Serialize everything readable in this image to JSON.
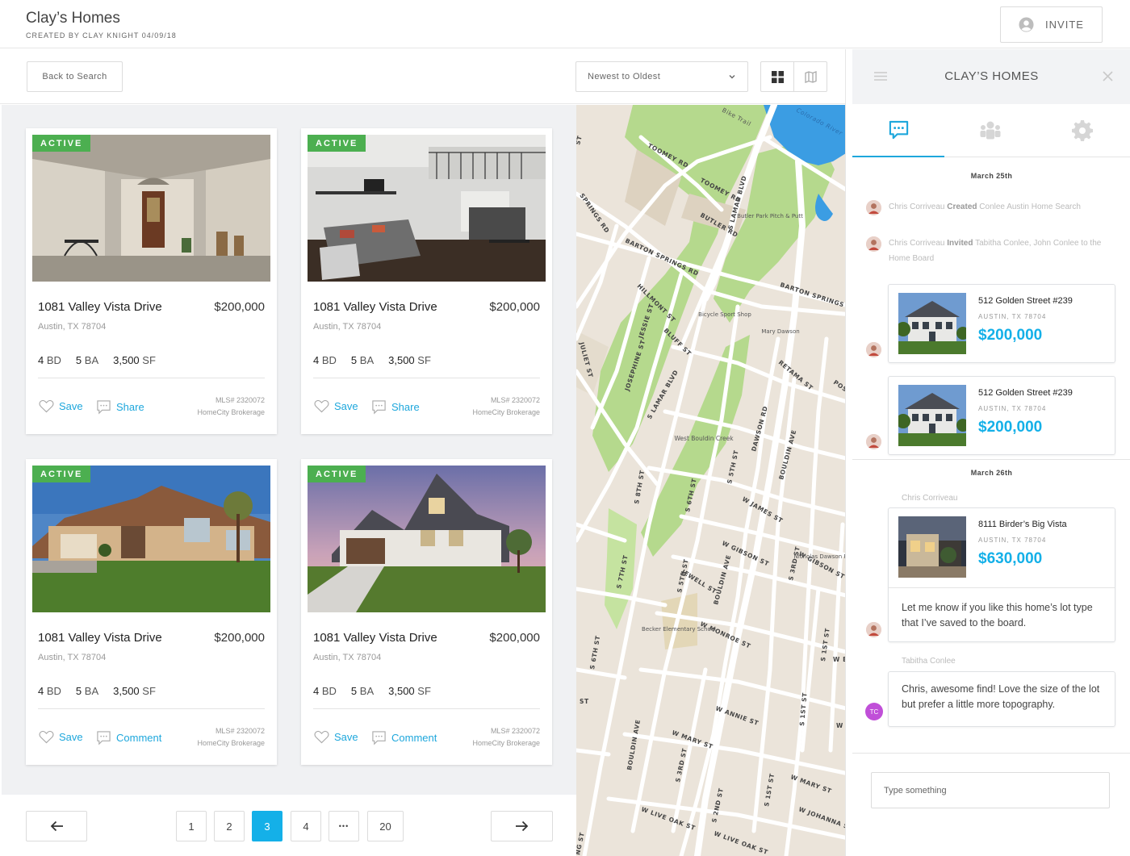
{
  "header": {
    "title": "Clay’s Homes",
    "subtitle": "CREATED BY CLAY KNIGHT 04/09/18",
    "invite_label": "INVITE"
  },
  "toolbar": {
    "back_label": "Back to Search",
    "sort_value": "Newest to Oldest"
  },
  "listings": [
    {
      "status": "ACTIVE",
      "address": "1081 Valley Vista Drive",
      "price": "$200,000",
      "city": "Austin, TX 78704",
      "beds": "4",
      "beds_unit": "BD",
      "baths": "5",
      "baths_unit": "BA",
      "sqft": "3,500",
      "sqft_unit": "SF",
      "save_label": "Save",
      "secondary_label": "Share",
      "mls": "MLS# 2320072",
      "brokerage": "HomeCity Brokerage",
      "photo": "porch"
    },
    {
      "status": "ACTIVE",
      "address": "1081 Valley Vista Drive",
      "price": "$200,000",
      "city": "Austin, TX 78704",
      "beds": "4",
      "beds_unit": "BD",
      "baths": "5",
      "baths_unit": "BA",
      "sqft": "3,500",
      "sqft_unit": "SF",
      "save_label": "Save",
      "secondary_label": "Share",
      "mls": "MLS# 2320072",
      "brokerage": "HomeCity Brokerage",
      "photo": "interior"
    },
    {
      "status": "ACTIVE",
      "address": "1081 Valley Vista Drive",
      "price": "$200,000",
      "city": "Austin, TX 78704",
      "beds": "4",
      "beds_unit": "BD",
      "baths": "5",
      "baths_unit": "BA",
      "sqft": "3,500",
      "sqft_unit": "SF",
      "save_label": "Save",
      "secondary_label": "Comment",
      "mls": "MLS# 2320072",
      "brokerage": "HomeCity Brokerage",
      "photo": "house-day"
    },
    {
      "status": "ACTIVE",
      "address": "1081 Valley Vista Drive",
      "price": "$200,000",
      "city": "Austin, TX 78704",
      "beds": "4",
      "beds_unit": "BD",
      "baths": "5",
      "baths_unit": "BA",
      "sqft": "3,500",
      "sqft_unit": "SF",
      "save_label": "Save",
      "secondary_label": "Comment",
      "mls": "MLS# 2320072",
      "brokerage": "HomeCity Brokerage",
      "photo": "house-dusk"
    }
  ],
  "pagination": {
    "prev": "arrow-left-icon",
    "pages": [
      "1",
      "2",
      "3",
      "4",
      "•••",
      "20"
    ],
    "current": "3",
    "next": "arrow-right-icon"
  },
  "map": {
    "streets": [
      "TOOMEY RD",
      "TOOMEY RD",
      "BUTLER RD",
      "S LAMAR BLVD",
      "BARTON SPRINGS RD",
      "BARTON SPRINGS RD",
      "HILLMONT ST",
      "JESSIE ST",
      "BLUFF ST",
      "JULIET ST",
      "JOSEPHINE ST",
      "S LAMAR BLVD",
      "RETAMA ST",
      "POST",
      "DAWSON RD",
      "BOULDIN AVE",
      "S 8TH ST",
      "S 6TH ST",
      "S 5TH ST",
      "W JAMES ST",
      "W GIBSON ST",
      "W GIBSON ST",
      "S 3RD ST",
      "S 7TH ST",
      "S 5TH ST",
      "JEWELL ST",
      "BOULDIN AVE",
      "W MONROE ST",
      "S 1ST ST",
      "S 6TH ST",
      "W ANNIE ST",
      "S 1ST ST",
      "W MARY ST",
      "W MARY ST",
      "S 3RD ST",
      "BOULDIN AVE",
      "S 2ND ST",
      "S 1ST ST",
      "W JOHANNA ST",
      "W LIVE OAK ST",
      "W LIVE OAK ST",
      "Colorado River",
      "Bike Trail",
      "ST",
      "NG ST",
      "SPRINGS RD",
      "W ELI",
      "W MI",
      "ST"
    ],
    "pois": [
      "Butler Park Pitch & Putt",
      "Bicycle Sport Shop",
      "Mary Dawson",
      "West Bouldin Creek",
      "Nicholas Dawson Park",
      "Becker Elementary School"
    ]
  },
  "panel": {
    "title": "CLAY’S HOMES",
    "menu_icon": "hamburger-icon",
    "close_icon": "close-icon",
    "tabs": [
      "chat-icon",
      "people-icon",
      "gear-icon"
    ],
    "active_tab": "chat-icon",
    "date1": "March 25th",
    "activity1": {
      "name": "Chris Corriveau",
      "verb": "Created",
      "object": "Conlee Austin Home Search"
    },
    "activity2": {
      "name": "Chris Corriveau",
      "verb": "Invited",
      "object": "Tabitha Conlee, John Conlee to the Home Board"
    },
    "shared1": {
      "address": "512 Golden Street #239",
      "city": "AUSTIN, TX 78704",
      "price": "$200,000"
    },
    "shared2": {
      "address": "512 Golden Street #239",
      "city": "AUSTIN, TX 78704",
      "price": "$200,000"
    },
    "date2": "March 26th",
    "sender1": "Chris Corriveau",
    "shared3": {
      "address": "8111 Birder’s Big Vista",
      "city": "AUSTIN, TX 78704",
      "price": "$630,000",
      "message": "Let me know if you like this home’s lot type that I’ve saved to the board."
    },
    "sender2": "Tabitha Conlee",
    "reply": "Chris, awesome find! Love the size of the lot but prefer a little more topography.",
    "reply_initials": "TC",
    "input_placeholder": "Type something"
  }
}
